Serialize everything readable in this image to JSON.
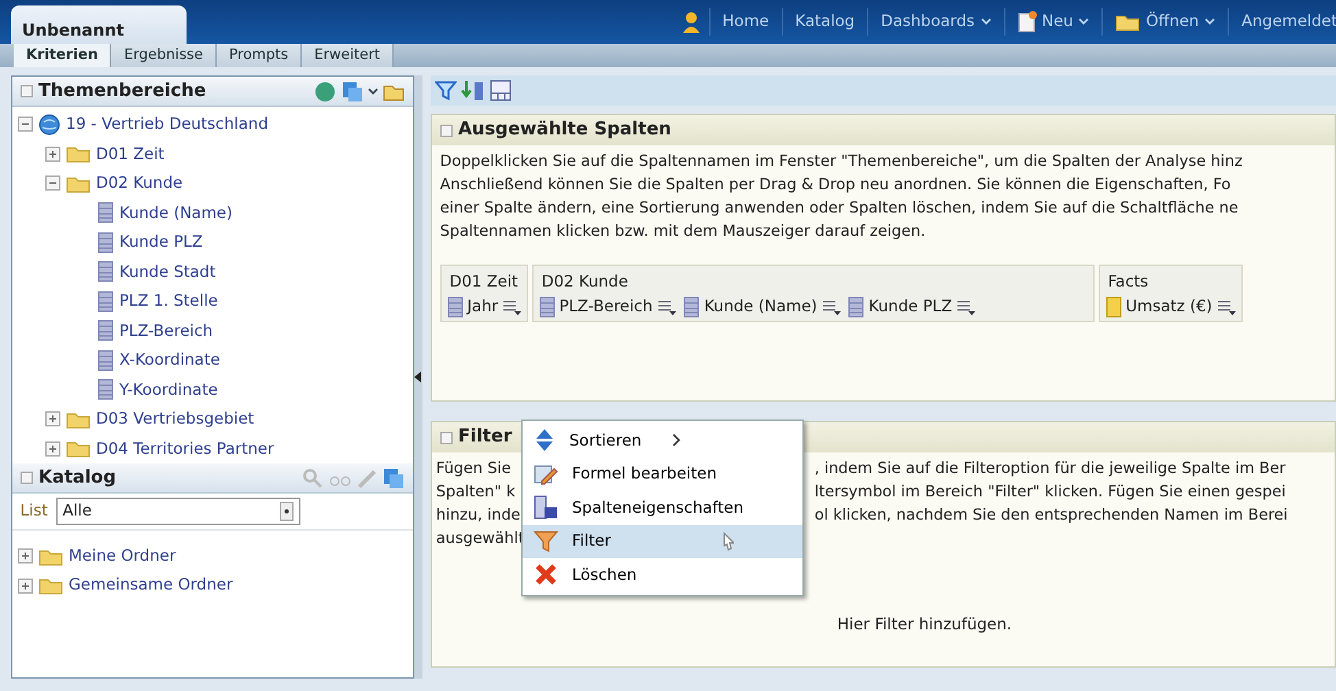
{
  "header": {
    "title": "Unbenannt",
    "nav": [
      {
        "label": "Home",
        "kind": "plain",
        "dropdown": false
      },
      {
        "label": "Katalog",
        "kind": "plain",
        "dropdown": false
      },
      {
        "label": "Dashboards",
        "kind": "plain",
        "dropdown": true
      },
      {
        "label": "Neu",
        "kind": "new",
        "dropdown": true
      },
      {
        "label": "Öffnen",
        "kind": "open",
        "dropdown": true
      },
      {
        "label": "Angemeldet",
        "kind": "plain",
        "dropdown": false
      }
    ]
  },
  "tabs": [
    {
      "label": "Kriterien",
      "selected": true
    },
    {
      "label": "Ergebnisse",
      "selected": false
    },
    {
      "label": "Prompts",
      "selected": false
    },
    {
      "label": "Erweitert",
      "selected": false
    }
  ],
  "subject_areas": {
    "title": "Themenbereiche",
    "tree": [
      {
        "label": "19 - Vertrieb Deutschland",
        "kind": "subject",
        "expanded": true,
        "children": [
          {
            "label": "D01 Zeit",
            "kind": "folder",
            "expanded": false
          },
          {
            "label": "D02 Kunde",
            "kind": "folder",
            "expanded": true,
            "children": [
              {
                "label": "Kunde (Name)",
                "kind": "column"
              },
              {
                "label": "Kunde PLZ",
                "kind": "column"
              },
              {
                "label": "Kunde Stadt",
                "kind": "column"
              },
              {
                "label": "PLZ 1. Stelle",
                "kind": "column"
              },
              {
                "label": "PLZ-Bereich",
                "kind": "column"
              },
              {
                "label": "X-Koordinate",
                "kind": "column"
              },
              {
                "label": "Y-Koordinate",
                "kind": "column"
              }
            ]
          },
          {
            "label": "D03 Vertriebsgebiet",
            "kind": "folder",
            "expanded": false
          },
          {
            "label": "D04 Territories Partner",
            "kind": "folder",
            "expanded": false
          }
        ]
      }
    ]
  },
  "catalog": {
    "title": "Katalog",
    "list_label": "List",
    "list_value": "Alle",
    "tree": [
      {
        "label": "Meine Ordner",
        "kind": "folder",
        "expanded": false
      },
      {
        "label": "Gemeinsame Ordner",
        "kind": "folder",
        "expanded": false
      }
    ]
  },
  "selected_columns": {
    "title": "Ausgewählte Spalten",
    "description_lines": [
      "Doppelklicken Sie auf die Spaltennamen im Fenster \"Themenbereiche\", um die Spalten der Analyse hinz",
      "Anschließend können Sie die Spalten per Drag & Drop neu anordnen. Sie können die Eigenschaften, Fo",
      "einer Spalte ändern, eine Sortierung anwenden oder Spalten löschen, indem Sie auf die Schaltfläche ne",
      "Spaltennamen klicken bzw. mit dem Mauszeiger darauf zeigen."
    ],
    "groups": [
      {
        "title": "D01 Zeit",
        "columns": [
          {
            "name": "Jahr",
            "kind": "attribute"
          }
        ]
      },
      {
        "title": "D02 Kunde",
        "columns": [
          {
            "name": "PLZ-Bereich",
            "kind": "attribute"
          },
          {
            "name": "Kunde (Name)",
            "kind": "attribute"
          },
          {
            "name": "Kunde PLZ",
            "kind": "attribute"
          }
        ]
      },
      {
        "title": "Facts",
        "columns": [
          {
            "name": "Umsatz (€)",
            "kind": "measure"
          }
        ]
      }
    ]
  },
  "context_menu": {
    "items": [
      {
        "label": "Sortieren",
        "kind": "sort",
        "submenu": true,
        "selected": false
      },
      {
        "label": "Formel bearbeiten",
        "kind": "formula",
        "submenu": false,
        "selected": false
      },
      {
        "label": "Spalteneigenschaften",
        "kind": "properties",
        "submenu": false,
        "selected": false
      },
      {
        "label": "Filter",
        "kind": "filter",
        "submenu": false,
        "selected": true
      },
      {
        "label": "Löschen",
        "kind": "delete",
        "submenu": false,
        "selected": false
      }
    ]
  },
  "filters": {
    "title": "Filter",
    "description_lines": [
      {
        "left": "Fügen Sie",
        "right": ", indem Sie auf die Filteroption für die jeweilige Spalte im Ber"
      },
      {
        "left": "Spalten\" k",
        "right": "ltersymbol im Bereich \"Filter\" klicken. Fügen Sie einen gespei"
      },
      {
        "left": "hinzu, inde",
        "right": "ol klicken, nachdem Sie den entsprechenden Namen im Berei"
      },
      {
        "left": "ausgewählt"
      }
    ],
    "empty_text": "Hier Filter hinzufügen."
  }
}
